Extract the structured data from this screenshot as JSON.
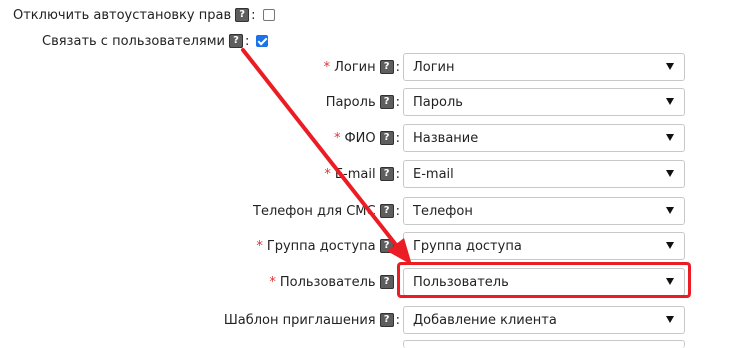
{
  "top_options": [
    {
      "label": "Отключить автоустановку прав",
      "help": "?",
      "checked": false
    },
    {
      "label": "Связать с пользователями",
      "help": "?",
      "checked": true
    }
  ],
  "fields": [
    {
      "label": "Логин",
      "required": true,
      "help": "?",
      "value": "Логин"
    },
    {
      "label": "Пароль",
      "required": false,
      "help": "?",
      "value": "Пароль"
    },
    {
      "label": "ФИО",
      "required": true,
      "help": "?",
      "value": "Название"
    },
    {
      "label": "E-mail",
      "required": true,
      "help": "?",
      "value": "E-mail"
    },
    {
      "label": "Телефон для СМС",
      "required": false,
      "help": "?",
      "value": "Телефон"
    },
    {
      "label": "Группа доступа",
      "required": true,
      "help": "?",
      "value": "Группа доступа"
    },
    {
      "label": "Пользователь",
      "required": true,
      "help": "?",
      "value": "Пользователь"
    },
    {
      "label": "Шаблон приглашения",
      "required": false,
      "help": "?",
      "value": "Добавление клиента"
    }
  ],
  "required_mark": "*",
  "colon": ":",
  "annotation": {
    "color": "#ec1c24",
    "highlighted_field": "Пользователь"
  }
}
